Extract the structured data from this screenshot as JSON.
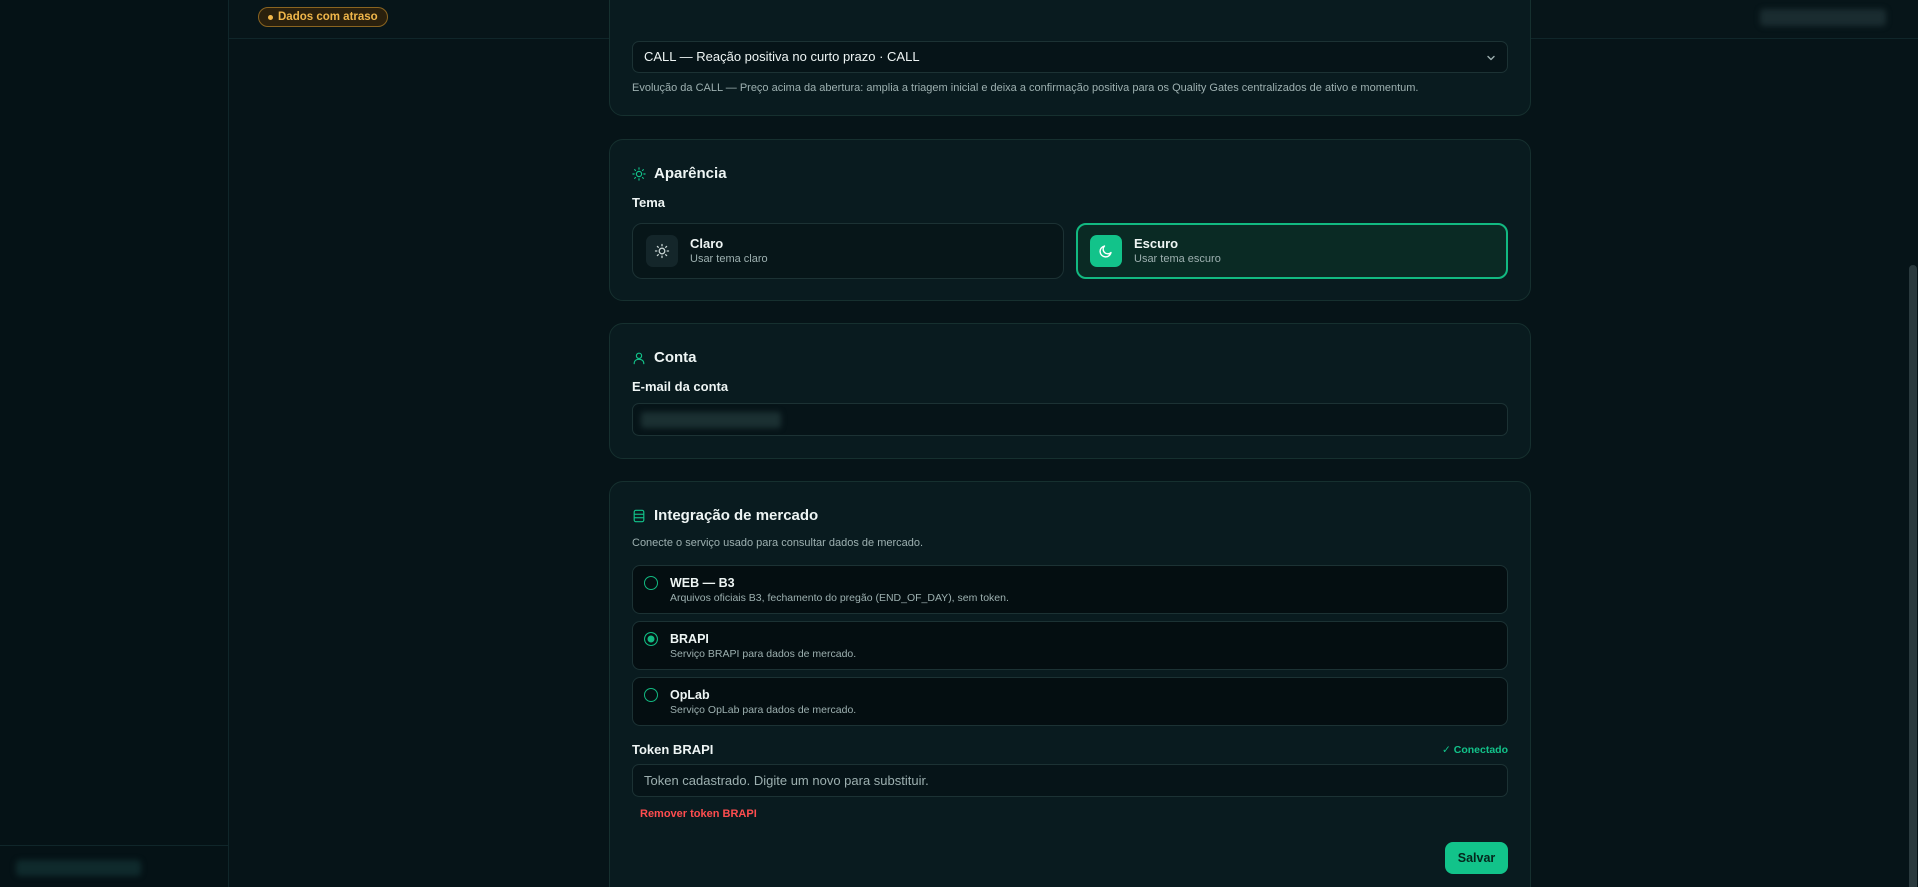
{
  "header": {
    "status_badge": "Dados com atraso"
  },
  "strategy": {
    "selected": "CALL — Reação positiva no curto prazo · CALL",
    "description": "Evolução da CALL — Preço acima da abertura: amplia a triagem inicial e deixa a confirmação positiva para os Quality Gates centralizados de ativo e momentum."
  },
  "appearance": {
    "title": "Aparência",
    "theme_label": "Tema",
    "options": [
      {
        "name": "Claro",
        "sub": "Usar tema claro",
        "icon": "sun-icon",
        "active": false
      },
      {
        "name": "Escuro",
        "sub": "Usar tema escuro",
        "icon": "moon-icon",
        "active": true
      }
    ]
  },
  "account": {
    "title": "Conta",
    "email_label": "E-mail da conta"
  },
  "market": {
    "title": "Integração de mercado",
    "description": "Conecte o serviço usado para consultar dados de mercado.",
    "providers": [
      {
        "name": "WEB — B3",
        "sub": "Arquivos oficiais B3, fechamento do pregão (END_OF_DAY), sem token.",
        "checked": false
      },
      {
        "name": "BRAPI",
        "sub": "Serviço BRAPI para dados de mercado.",
        "checked": true
      },
      {
        "name": "OpLab",
        "sub": "Serviço OpLab para dados de mercado.",
        "checked": false
      }
    ],
    "token_label": "Token BRAPI",
    "connected_label": "✓ Conectado",
    "token_placeholder": "Token cadastrado. Digite um novo para substituir.",
    "remove_label": "Remover token BRAPI",
    "save_label": "Salvar"
  },
  "colors": {
    "accent": "#12c38a",
    "warning": "#f0b64a",
    "danger": "#ff4d4f",
    "background": "#061418"
  }
}
